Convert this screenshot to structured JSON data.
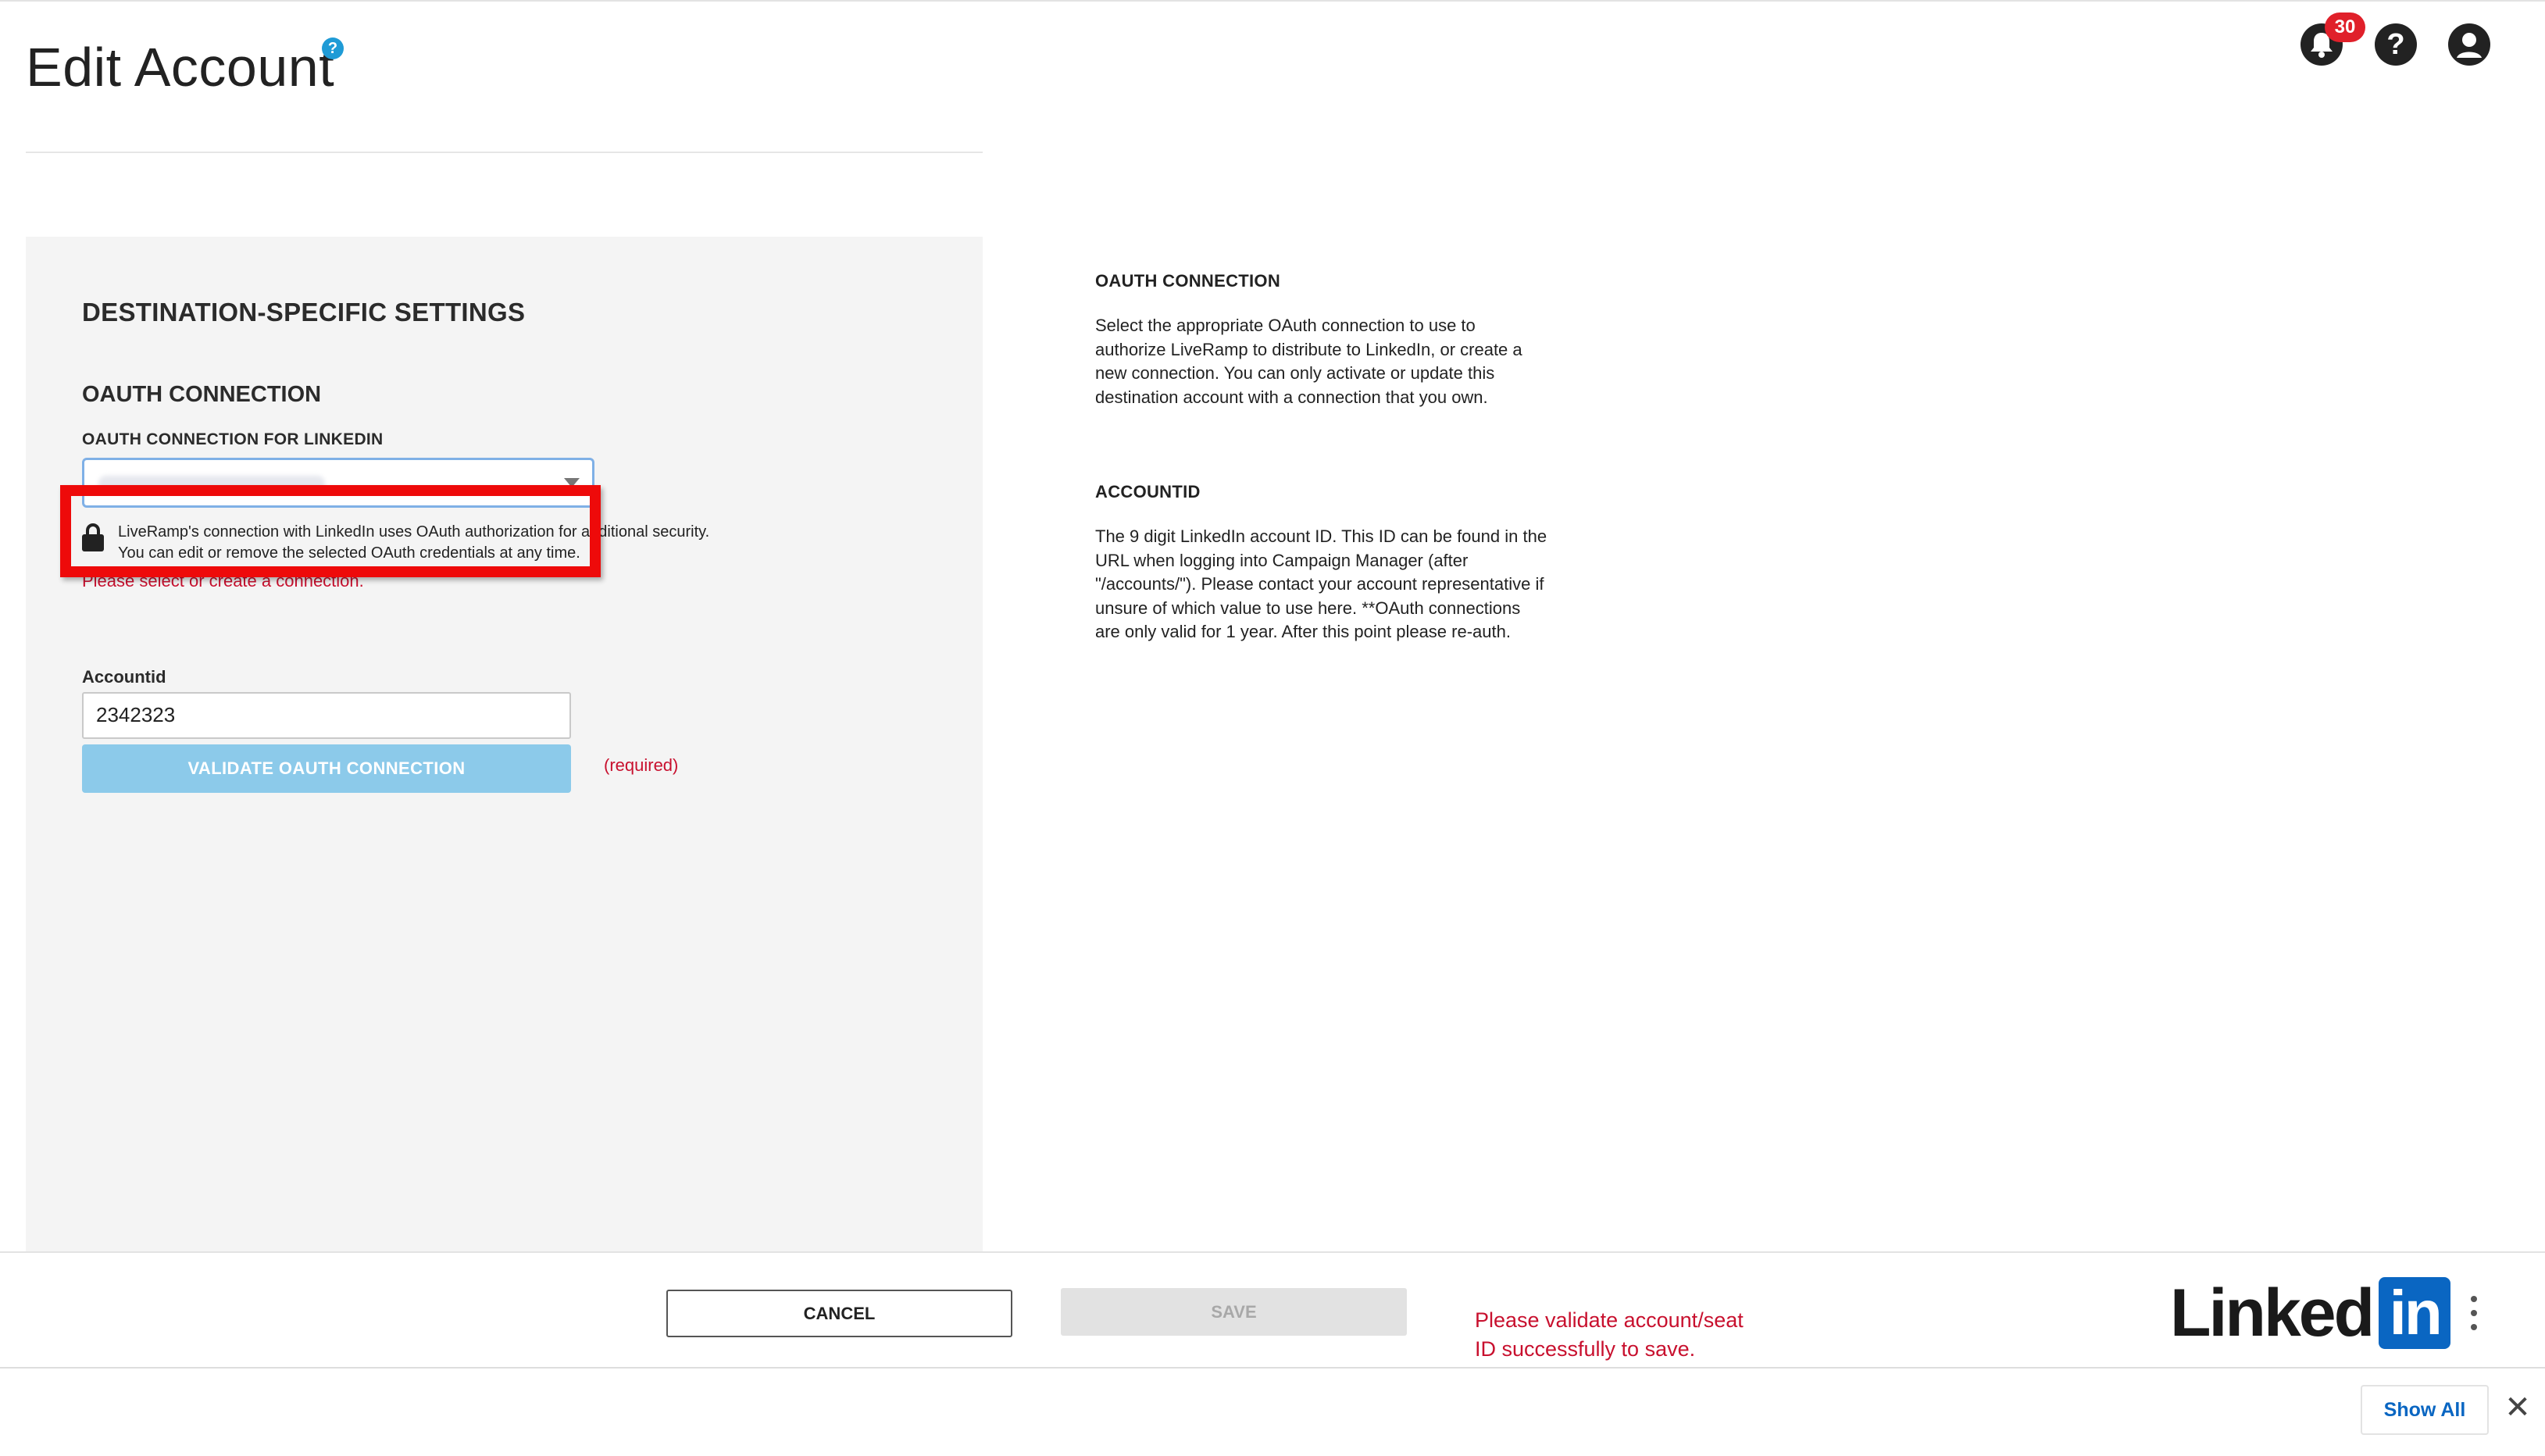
{
  "page": {
    "title": "Edit Account",
    "help_glyph": "?"
  },
  "header": {
    "notifications_count": "30",
    "help_glyph": "?"
  },
  "settings": {
    "section_title": "DESTINATION-SPECIFIC SETTINGS",
    "oauth_title": "OAUTH CONNECTION",
    "oauth_field_label": "OAUTH CONNECTION FOR LINKEDIN",
    "security_note_line1": "LiveRamp's connection with LinkedIn uses OAuth authorization for additional security.",
    "security_note_line2": "You can edit or remove the selected OAuth credentials at any time.",
    "select_error": "Please select or create a connection.",
    "account_label": "Accountid",
    "account_value": "2342323",
    "validate_label": "VALIDATE OAUTH CONNECTION",
    "required_text": "(required)"
  },
  "help_panel": {
    "oauth_heading": "OAUTH CONNECTION",
    "oauth_text": "Select the appropriate OAuth connection to use to authorize LiveRamp to distribute to LinkedIn, or create a new connection. You can only activate or update this destination account with a connection that you own.",
    "account_heading": "ACCOUNTID",
    "account_text": "The 9 digit LinkedIn account ID. This ID can be found in the URL when logging into Campaign Manager (after \"/accounts/\"). Please contact your account representative if unsure of which value to use here. **OAuth connections are only valid for 1 year. After this point please re-auth."
  },
  "footer": {
    "cancel_label": "CANCEL",
    "save_label": "SAVE",
    "save_error": "Please validate account/seat ID successfully to save.",
    "logo_text": "Linked",
    "logo_box_text": "in"
  },
  "bottom_bar": {
    "show_all_label": "Show All",
    "close_glyph": "✕"
  },
  "colors": {
    "accent": "#1f9bd6",
    "error": "#c8102e",
    "highlight": "#ee0a0a",
    "linkedin_blue": "#0a66c2"
  }
}
